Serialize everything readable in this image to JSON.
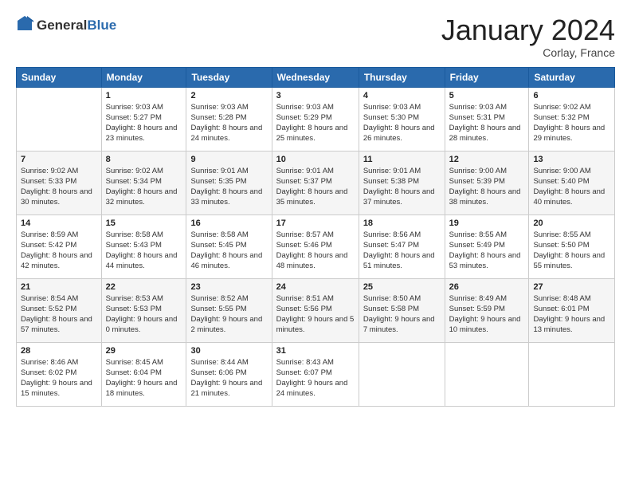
{
  "header": {
    "logo_general": "General",
    "logo_blue": "Blue",
    "month_title": "January 2024",
    "location": "Corlay, France"
  },
  "days_of_week": [
    "Sunday",
    "Monday",
    "Tuesday",
    "Wednesday",
    "Thursday",
    "Friday",
    "Saturday"
  ],
  "weeks": [
    [
      {
        "day": "",
        "sunrise": "",
        "sunset": "",
        "daylight": ""
      },
      {
        "day": "1",
        "sunrise": "Sunrise: 9:03 AM",
        "sunset": "Sunset: 5:27 PM",
        "daylight": "Daylight: 8 hours and 23 minutes."
      },
      {
        "day": "2",
        "sunrise": "Sunrise: 9:03 AM",
        "sunset": "Sunset: 5:28 PM",
        "daylight": "Daylight: 8 hours and 24 minutes."
      },
      {
        "day": "3",
        "sunrise": "Sunrise: 9:03 AM",
        "sunset": "Sunset: 5:29 PM",
        "daylight": "Daylight: 8 hours and 25 minutes."
      },
      {
        "day": "4",
        "sunrise": "Sunrise: 9:03 AM",
        "sunset": "Sunset: 5:30 PM",
        "daylight": "Daylight: 8 hours and 26 minutes."
      },
      {
        "day": "5",
        "sunrise": "Sunrise: 9:03 AM",
        "sunset": "Sunset: 5:31 PM",
        "daylight": "Daylight: 8 hours and 28 minutes."
      },
      {
        "day": "6",
        "sunrise": "Sunrise: 9:02 AM",
        "sunset": "Sunset: 5:32 PM",
        "daylight": "Daylight: 8 hours and 29 minutes."
      }
    ],
    [
      {
        "day": "7",
        "sunrise": "Sunrise: 9:02 AM",
        "sunset": "Sunset: 5:33 PM",
        "daylight": "Daylight: 8 hours and 30 minutes."
      },
      {
        "day": "8",
        "sunrise": "Sunrise: 9:02 AM",
        "sunset": "Sunset: 5:34 PM",
        "daylight": "Daylight: 8 hours and 32 minutes."
      },
      {
        "day": "9",
        "sunrise": "Sunrise: 9:01 AM",
        "sunset": "Sunset: 5:35 PM",
        "daylight": "Daylight: 8 hours and 33 minutes."
      },
      {
        "day": "10",
        "sunrise": "Sunrise: 9:01 AM",
        "sunset": "Sunset: 5:37 PM",
        "daylight": "Daylight: 8 hours and 35 minutes."
      },
      {
        "day": "11",
        "sunrise": "Sunrise: 9:01 AM",
        "sunset": "Sunset: 5:38 PM",
        "daylight": "Daylight: 8 hours and 37 minutes."
      },
      {
        "day": "12",
        "sunrise": "Sunrise: 9:00 AM",
        "sunset": "Sunset: 5:39 PM",
        "daylight": "Daylight: 8 hours and 38 minutes."
      },
      {
        "day": "13",
        "sunrise": "Sunrise: 9:00 AM",
        "sunset": "Sunset: 5:40 PM",
        "daylight": "Daylight: 8 hours and 40 minutes."
      }
    ],
    [
      {
        "day": "14",
        "sunrise": "Sunrise: 8:59 AM",
        "sunset": "Sunset: 5:42 PM",
        "daylight": "Daylight: 8 hours and 42 minutes."
      },
      {
        "day": "15",
        "sunrise": "Sunrise: 8:58 AM",
        "sunset": "Sunset: 5:43 PM",
        "daylight": "Daylight: 8 hours and 44 minutes."
      },
      {
        "day": "16",
        "sunrise": "Sunrise: 8:58 AM",
        "sunset": "Sunset: 5:45 PM",
        "daylight": "Daylight: 8 hours and 46 minutes."
      },
      {
        "day": "17",
        "sunrise": "Sunrise: 8:57 AM",
        "sunset": "Sunset: 5:46 PM",
        "daylight": "Daylight: 8 hours and 48 minutes."
      },
      {
        "day": "18",
        "sunrise": "Sunrise: 8:56 AM",
        "sunset": "Sunset: 5:47 PM",
        "daylight": "Daylight: 8 hours and 51 minutes."
      },
      {
        "day": "19",
        "sunrise": "Sunrise: 8:55 AM",
        "sunset": "Sunset: 5:49 PM",
        "daylight": "Daylight: 8 hours and 53 minutes."
      },
      {
        "day": "20",
        "sunrise": "Sunrise: 8:55 AM",
        "sunset": "Sunset: 5:50 PM",
        "daylight": "Daylight: 8 hours and 55 minutes."
      }
    ],
    [
      {
        "day": "21",
        "sunrise": "Sunrise: 8:54 AM",
        "sunset": "Sunset: 5:52 PM",
        "daylight": "Daylight: 8 hours and 57 minutes."
      },
      {
        "day": "22",
        "sunrise": "Sunrise: 8:53 AM",
        "sunset": "Sunset: 5:53 PM",
        "daylight": "Daylight: 9 hours and 0 minutes."
      },
      {
        "day": "23",
        "sunrise": "Sunrise: 8:52 AM",
        "sunset": "Sunset: 5:55 PM",
        "daylight": "Daylight: 9 hours and 2 minutes."
      },
      {
        "day": "24",
        "sunrise": "Sunrise: 8:51 AM",
        "sunset": "Sunset: 5:56 PM",
        "daylight": "Daylight: 9 hours and 5 minutes."
      },
      {
        "day": "25",
        "sunrise": "Sunrise: 8:50 AM",
        "sunset": "Sunset: 5:58 PM",
        "daylight": "Daylight: 9 hours and 7 minutes."
      },
      {
        "day": "26",
        "sunrise": "Sunrise: 8:49 AM",
        "sunset": "Sunset: 5:59 PM",
        "daylight": "Daylight: 9 hours and 10 minutes."
      },
      {
        "day": "27",
        "sunrise": "Sunrise: 8:48 AM",
        "sunset": "Sunset: 6:01 PM",
        "daylight": "Daylight: 9 hours and 13 minutes."
      }
    ],
    [
      {
        "day": "28",
        "sunrise": "Sunrise: 8:46 AM",
        "sunset": "Sunset: 6:02 PM",
        "daylight": "Daylight: 9 hours and 15 minutes."
      },
      {
        "day": "29",
        "sunrise": "Sunrise: 8:45 AM",
        "sunset": "Sunset: 6:04 PM",
        "daylight": "Daylight: 9 hours and 18 minutes."
      },
      {
        "day": "30",
        "sunrise": "Sunrise: 8:44 AM",
        "sunset": "Sunset: 6:06 PM",
        "daylight": "Daylight: 9 hours and 21 minutes."
      },
      {
        "day": "31",
        "sunrise": "Sunrise: 8:43 AM",
        "sunset": "Sunset: 6:07 PM",
        "daylight": "Daylight: 9 hours and 24 minutes."
      },
      {
        "day": "",
        "sunrise": "",
        "sunset": "",
        "daylight": ""
      },
      {
        "day": "",
        "sunrise": "",
        "sunset": "",
        "daylight": ""
      },
      {
        "day": "",
        "sunrise": "",
        "sunset": "",
        "daylight": ""
      }
    ]
  ]
}
